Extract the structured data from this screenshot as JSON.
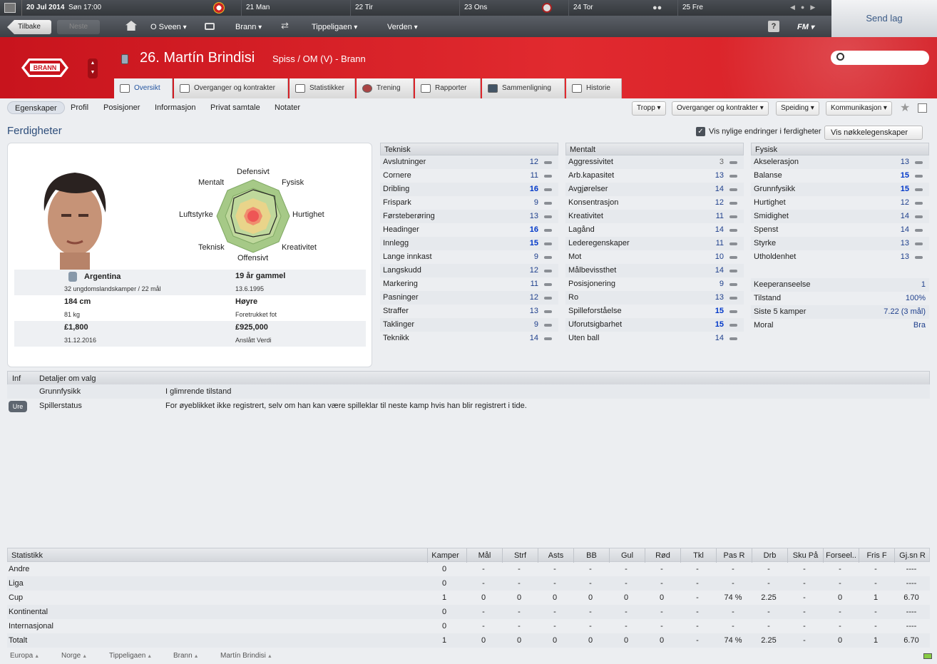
{
  "topbar": {
    "date": "20 Jul 2014",
    "day_time": "Søn 17:00",
    "days": [
      {
        "label": "21 Man"
      },
      {
        "label": "22 Tir"
      },
      {
        "label": "23 Ons"
      },
      {
        "label": "24 Tor"
      },
      {
        "label": "25 Fre"
      }
    ],
    "send_label": "Send lag"
  },
  "navbar": {
    "back": "Tilbake",
    "next": "Neste",
    "manager": "O Sveen",
    "club": "Brann",
    "league": "Tippeligaen",
    "world": "Verden",
    "fm": "FM",
    "help": "?"
  },
  "player": {
    "number_name": "26. Martín Brindisi",
    "positions": "Spiss / OM (V) - Brann",
    "club_logo_text": "BRANN"
  },
  "tabs": [
    {
      "label": "Oversikt",
      "icon": "profile-card-icon"
    },
    {
      "label": "Overganger og kontrakter",
      "icon": "document-icon"
    },
    {
      "label": "Statistikker",
      "icon": "bar-chart-icon"
    },
    {
      "label": "Trening",
      "icon": "ball-icon"
    },
    {
      "label": "Rapporter",
      "icon": "report-icon"
    },
    {
      "label": "Sammenligning",
      "icon": "compare-icon"
    },
    {
      "label": "Historie",
      "icon": "history-icon"
    }
  ],
  "subnav": {
    "items": [
      "Egenskaper",
      "Profil",
      "Posisjoner",
      "Informasjon",
      "Privat samtale",
      "Notater"
    ],
    "dropdowns": [
      "Tropp",
      "Overganger og kontrakter",
      "Speiding",
      "Kommunikasjon"
    ]
  },
  "section": {
    "title": "Ferdigheter",
    "checkbox_label": "Vis nylige endringer i ferdigheter",
    "key_attr": "Vis nøkkelegenskaper"
  },
  "radar": {
    "labels": [
      "Defensivt",
      "Fysisk",
      "Hurtighet",
      "Kreativitet",
      "Offensivt",
      "Teknisk",
      "Luftstyrke",
      "Mentalt"
    ]
  },
  "info": {
    "nation": "Argentina",
    "youth_caps": "32 ungdomslandskamper / 22 mål",
    "age": "19 år gammel",
    "dob": "13.6.1995",
    "height": "184 cm",
    "weight": "81 kg",
    "foot": "Høyre",
    "foot_label": "Foretrukket fot",
    "wage": "£1,800",
    "contract": "31.12.2016",
    "value": "£925,000",
    "value_label": "Anslått Verdi"
  },
  "technical": {
    "header": "Teknisk",
    "rows": [
      {
        "name": "Avslutninger",
        "value": "12"
      },
      {
        "name": "Cornere",
        "value": "11"
      },
      {
        "name": "Dribling",
        "value": "16"
      },
      {
        "name": "Frispark",
        "value": "9"
      },
      {
        "name": "Førsteberøring",
        "value": "13"
      },
      {
        "name": "Headinger",
        "value": "16"
      },
      {
        "name": "Innlegg",
        "value": "15"
      },
      {
        "name": "Lange innkast",
        "value": "9"
      },
      {
        "name": "Langskudd",
        "value": "12"
      },
      {
        "name": "Markering",
        "value": "11"
      },
      {
        "name": "Pasninger",
        "value": "12"
      },
      {
        "name": "Straffer",
        "value": "13"
      },
      {
        "name": "Taklinger",
        "value": "9"
      },
      {
        "name": "Teknikk",
        "value": "14"
      }
    ]
  },
  "mental": {
    "header": "Mentalt",
    "rows": [
      {
        "name": "Aggressivitet",
        "value": "3"
      },
      {
        "name": "Arb.kapasitet",
        "value": "13"
      },
      {
        "name": "Avgjørelser",
        "value": "14"
      },
      {
        "name": "Konsentrasjon",
        "value": "12"
      },
      {
        "name": "Kreativitet",
        "value": "11"
      },
      {
        "name": "Lagånd",
        "value": "14"
      },
      {
        "name": "Lederegenskaper",
        "value": "11"
      },
      {
        "name": "Mot",
        "value": "10"
      },
      {
        "name": "Målbevissthet",
        "value": "14"
      },
      {
        "name": "Posisjonering",
        "value": "9"
      },
      {
        "name": "Ro",
        "value": "13"
      },
      {
        "name": "Spilleforståelse",
        "value": "15"
      },
      {
        "name": "Uforutsigbarhet",
        "value": "15"
      },
      {
        "name": "Uten ball",
        "value": "14"
      }
    ]
  },
  "physical": {
    "header": "Fysisk",
    "rows": [
      {
        "name": "Akselerasjon",
        "value": "13"
      },
      {
        "name": "Balanse",
        "value": "15"
      },
      {
        "name": "Grunnfysikk",
        "value": "15"
      },
      {
        "name": "Hurtighet",
        "value": "12"
      },
      {
        "name": "Smidighet",
        "value": "14"
      },
      {
        "name": "Spenst",
        "value": "14"
      },
      {
        "name": "Styrke",
        "value": "13"
      },
      {
        "name": "Utholdenhet",
        "value": "13"
      }
    ],
    "extra": [
      {
        "name": "Keeperanseelse",
        "value": "1"
      },
      {
        "name": "Tilstand",
        "value": "100%"
      },
      {
        "name": "Siste 5 kamper",
        "value": "7.22 (3 mål)"
      },
      {
        "name": "Moral",
        "value": "Bra"
      }
    ]
  },
  "details": {
    "col1": "Inf",
    "col2": "Detaljer om valg",
    "rows": [
      {
        "badge": "",
        "name": "Grunnfysikk",
        "text": "I glimrende tilstand"
      },
      {
        "badge": "Ure",
        "name": "Spillerstatus",
        "text": "For øyeblikket ikke registrert, selv om han kan være spilleklar til neste kamp hvis han blir registrert i tide."
      }
    ]
  },
  "stats": {
    "headers": [
      "Statistikk",
      "Kamper",
      "Mål",
      "Strf",
      "Asts",
      "BB",
      "Gul",
      "Rød",
      "Tkl",
      "Pas R",
      "Drb",
      "Sku På",
      "Forseel..",
      "Fris F",
      "Gj.sn R"
    ],
    "rows": [
      [
        "Andre",
        "0",
        "-",
        "-",
        "-",
        "-",
        "-",
        "-",
        "-",
        "-",
        "-",
        "-",
        "-",
        "-",
        "----"
      ],
      [
        "Liga",
        "0",
        "-",
        "-",
        "-",
        "-",
        "-",
        "-",
        "-",
        "-",
        "-",
        "-",
        "-",
        "-",
        "----"
      ],
      [
        "Cup",
        "1",
        "0",
        "0",
        "0",
        "0",
        "0",
        "0",
        "-",
        "74 %",
        "2.25",
        "-",
        "0",
        "1",
        "6.70"
      ],
      [
        "Kontinental",
        "0",
        "-",
        "-",
        "-",
        "-",
        "-",
        "-",
        "-",
        "-",
        "-",
        "-",
        "-",
        "-",
        "----"
      ],
      [
        "Internasjonal",
        "0",
        "-",
        "-",
        "-",
        "-",
        "-",
        "-",
        "-",
        "-",
        "-",
        "-",
        "-",
        "-",
        "----"
      ],
      [
        "Totalt",
        "1",
        "0",
        "0",
        "0",
        "0",
        "0",
        "0",
        "-",
        "74 %",
        "2.25",
        "-",
        "0",
        "1",
        "6.70"
      ]
    ]
  },
  "footer": [
    "Europa",
    "Norge",
    "Tippeligaen",
    "Brann",
    "Martín Brindisi"
  ],
  "colors": {
    "accent_red": "#d41e25",
    "value_blue": "#1e3f8c",
    "high_blue": "#0037c9"
  }
}
